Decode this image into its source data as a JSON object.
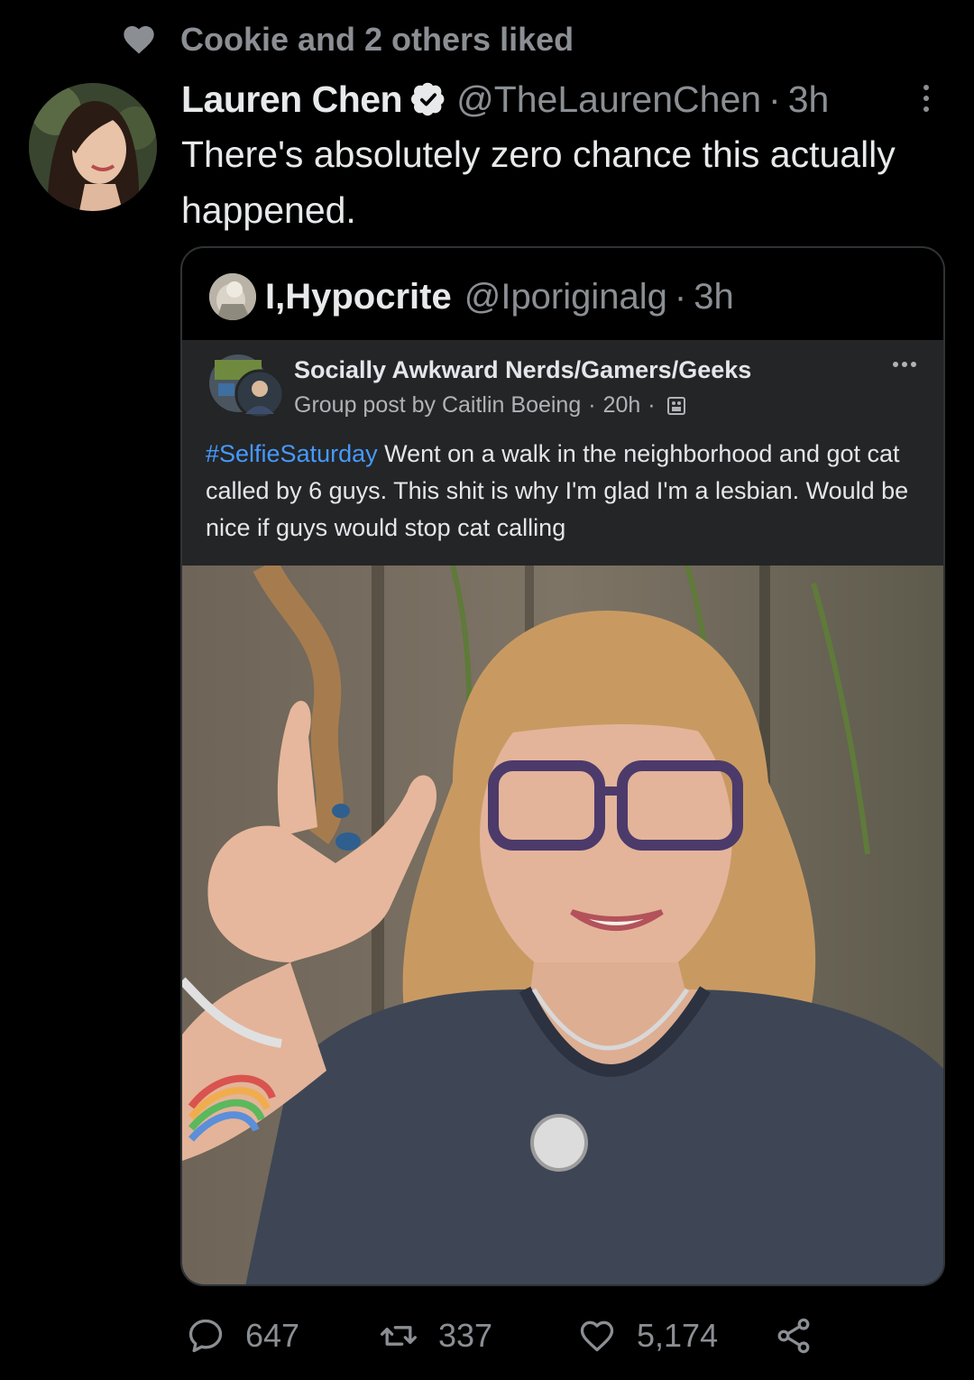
{
  "social_context": {
    "text": "Cookie and 2 others liked",
    "icon": "heart-icon"
  },
  "tweet": {
    "display_name": "Lauren Chen",
    "handle": "@TheLaurenChen",
    "separator": "·",
    "time": "3h",
    "text": "There's absolutely zero chance this actually happened."
  },
  "quote": {
    "display_name": "I,Hypocrite",
    "handle": "@Iporiginalg",
    "separator": "·",
    "time": "3h",
    "embedded_post": {
      "group_name": "Socially Awkward Nerds/Gamers/Geeks",
      "byline": "Group post by Caitlin Boeing",
      "separator": "·",
      "time": "20h",
      "hashtag": "#SelfieSaturday",
      "body": " Went on a walk in the neighborhood and got cat called by 6 guys. This shit is why I'm glad I'm a lesbian. Would be nice if guys would stop cat calling"
    }
  },
  "actions": {
    "replies": "647",
    "retweets": "337",
    "likes": "5,174"
  },
  "colors": {
    "background": "#000000",
    "primary_text": "#e7e9ea",
    "secondary_text": "#8b8f94",
    "verified_badge": "#e7e9ea",
    "fb_panel": "#242526",
    "fb_hashtag": "#4599ff"
  }
}
